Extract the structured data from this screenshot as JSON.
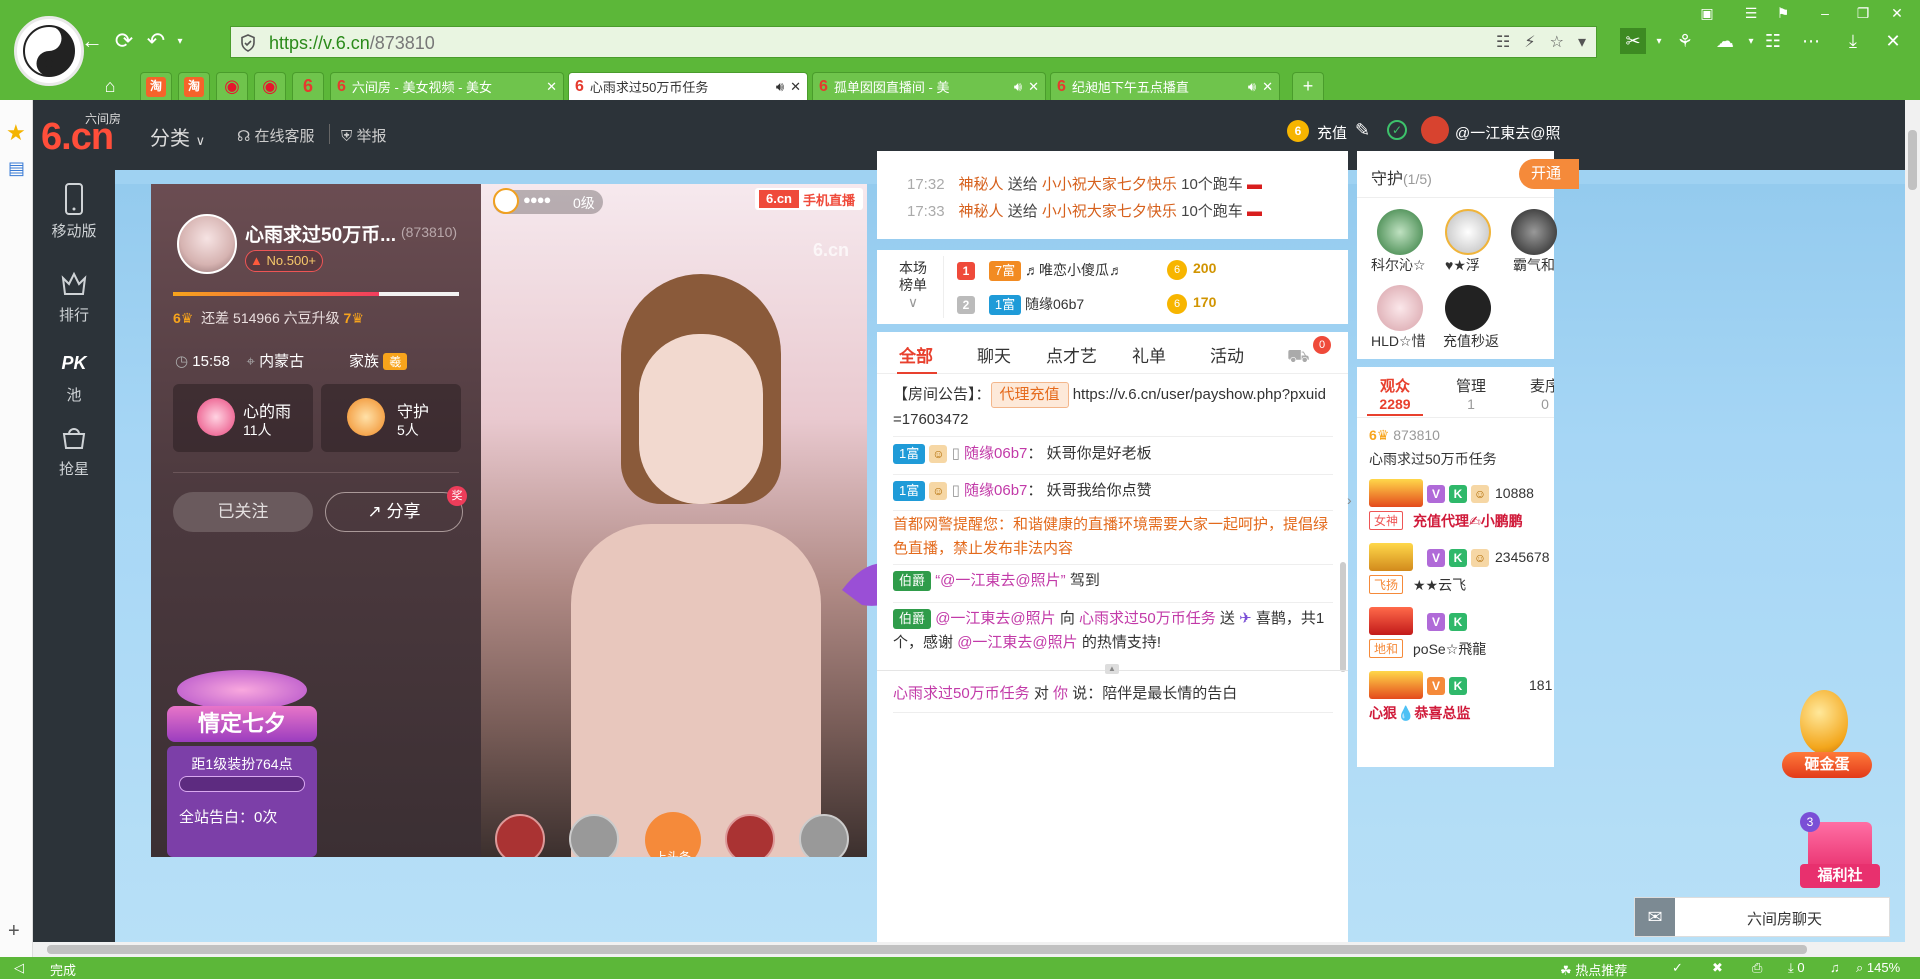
{
  "browser": {
    "url_prefix": "https://",
    "url_domain": "v.6.cn",
    "url_path": "/873810",
    "tabs": [
      {
        "label": "六间房 - 美女视频 - 美女",
        "active": false
      },
      {
        "label": "心雨求过50万币任务",
        "active": true
      },
      {
        "label": "孤单囡囡直播间 - 美",
        "active": false
      },
      {
        "label": "纪昶旭下午五点播直",
        "active": false
      }
    ],
    "pinned_tabs": [
      "淘",
      "淘",
      "微博",
      "微博",
      "6"
    ],
    "new_tab": "+",
    "status_left": "完成",
    "status_hot": "热点推荐",
    "status_count": "0",
    "zoom": "145%"
  },
  "site": {
    "logo_small": "六间房",
    "logo_big": "6.cn",
    "nav": [
      {
        "label": "分类"
      },
      {
        "label": "在线客服"
      },
      {
        "label": "举报"
      }
    ],
    "recharge": "充值",
    "username": "@一江東去@照",
    "left_nav": [
      {
        "label": "移动版"
      },
      {
        "label": "排行"
      },
      {
        "label": "池"
      },
      {
        "label": "抢星"
      }
    ],
    "left_nav_pk": "PK"
  },
  "anchor": {
    "name": "心雨求过50万币...",
    "room_id": "(873810)",
    "rank_badge": "No.500+",
    "level_from": "6",
    "upgrade_text": "还差 514966 六豆升级",
    "level_to": "7",
    "time": "15:58",
    "location": "内蒙古",
    "family_label": "家族",
    "family_badge": "羲",
    "fans_name": "心的雨",
    "fans_count": "11人",
    "guard_name": "守护",
    "guard_count": "5人",
    "follow_button": "已关注",
    "share_button": "分享",
    "share_badge": "奖",
    "promo_title": "情定七夕",
    "promo_line": "距1级装扮764点",
    "promo_bottom": "全站告白：0次",
    "level_progress": 0.72
  },
  "video": {
    "level_text": "0级",
    "brand": "6.cn",
    "brand_tag": "手机直播",
    "watermark": "6.cn",
    "bottom_btn": "上头条"
  },
  "gifts": [
    {
      "time": "17:32",
      "from": "神秘人",
      "verb": "送给",
      "to": "小小祝大家七夕快乐",
      "what": "10个跑车"
    },
    {
      "time": "17:33",
      "from": "神秘人",
      "verb": "送给",
      "to": "小小祝大家七夕快乐",
      "what": "10个跑车"
    }
  ],
  "ranking": {
    "label_line1": "本场",
    "label_line2": "榜单",
    "rows": [
      {
        "rank": "1",
        "level": "7富",
        "name": "♬唯恋小傻瓜♬",
        "score": "200"
      },
      {
        "rank": "2",
        "level": "1富",
        "name": "随缘06b7",
        "score": "170"
      }
    ]
  },
  "chat": {
    "tabs": [
      "全部",
      "聊天",
      "点才艺",
      "礼单",
      "活动"
    ],
    "car_badge": "0",
    "notice_label": "【房间公告】：",
    "notice_btn": "代理充值",
    "notice_url": "https://v.6.cn/user/payshow.php?pxuid=17603472",
    "messages": [
      {
        "level": "1富",
        "user": "随缘06b7",
        "sep": "：",
        "text": "妖哥你是好老板"
      },
      {
        "level": "1富",
        "user": "随缘06b7",
        "sep": "：",
        "text": "妖哥我给你点赞"
      }
    ],
    "warning": "首都网警提醒您：和谐健康的直播环境需要大家一起呵护，提倡绿色直播，禁止发布非法内容",
    "enter_badge": "伯爵",
    "enter_user": "“@一江東去@照片”",
    "enter_text": "驾到",
    "gift_badge": "伯爵",
    "gift_user": "@一江東去@照片",
    "gift_mid": "向",
    "gift_target": "心雨求过50万币任务",
    "gift_verb": "送",
    "gift_item": "喜鹊，共1个，感谢",
    "gift_thanks_user": "@一江東去@照片",
    "gift_thanks_tail": "的热情支持!",
    "private_from": "心雨求过50万币任务",
    "private_mid": "对",
    "private_to": "你",
    "private_say": "说：陪伴是最长情的告白"
  },
  "guard": {
    "title": "守护",
    "count": "(1/5)",
    "open_btn": "开通",
    "members": [
      "科尔沁☆",
      "♥★浮",
      "霸气和",
      "HLD☆惜",
      "充值秒返"
    ]
  },
  "audience": {
    "tabs": [
      {
        "label": "观众",
        "count": "2289"
      },
      {
        "label": "管理",
        "count": "1"
      },
      {
        "label": "麦序",
        "count": "0"
      }
    ],
    "anchor_level": "6",
    "anchor_id": "873810",
    "anchor_name": "心雨求过50万币任务",
    "users": [
      {
        "id": "10888",
        "tag": "女神",
        "name": "充值代理✍小鹏鹏"
      },
      {
        "id": "2345678",
        "tag": "飞扬",
        "name": "★★云飞"
      },
      {
        "id": "",
        "tag": "地和",
        "name": "ƿoSe☆飛龍"
      },
      {
        "id": "181",
        "tag": "",
        "name": "心狠💧恭喜总监"
      }
    ],
    "egg_label": "砸金蛋",
    "welfare_label": "福利社",
    "welfare_badge": "3",
    "chat_label": "六间房聊天"
  }
}
